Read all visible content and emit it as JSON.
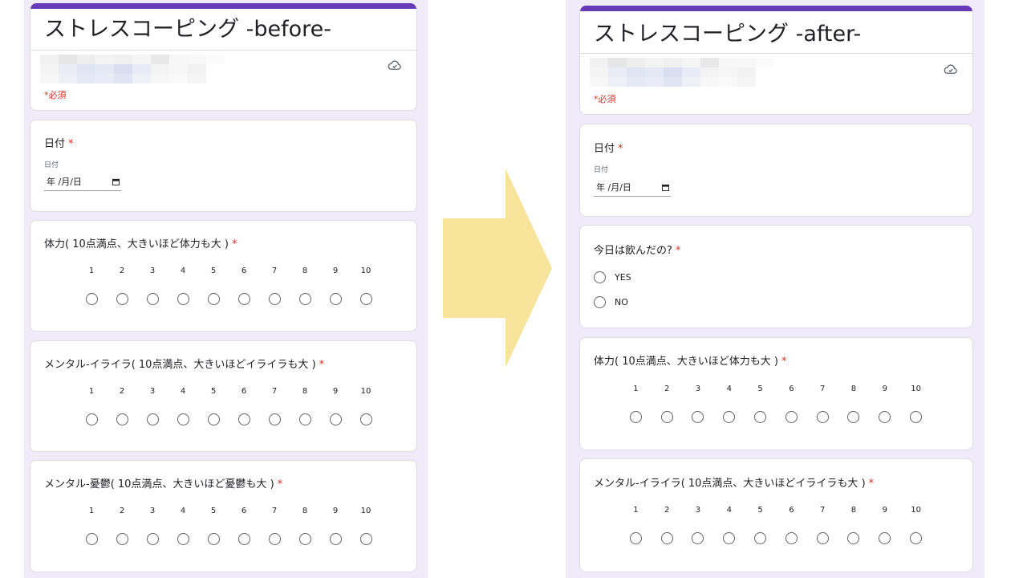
{
  "before": {
    "title": "ストレスコーピング -before-",
    "required_note": "*必須",
    "questions": [
      {
        "title": "日付",
        "sub_label": "日付",
        "date_value": "年 /月/日"
      },
      {
        "title": "体力( 10点満点、大きいほど体力も大 )",
        "scale": [
          "1",
          "2",
          "3",
          "4",
          "5",
          "6",
          "7",
          "8",
          "9",
          "10"
        ]
      },
      {
        "title": "メンタル-イライラ( 10点満点、大きいほどイライラも大 )",
        "scale": [
          "1",
          "2",
          "3",
          "4",
          "5",
          "6",
          "7",
          "8",
          "9",
          "10"
        ]
      },
      {
        "title": "メンタル-憂鬱( 10点満点、大きいほど憂鬱も大 )",
        "scale": [
          "1",
          "2",
          "3",
          "4",
          "5",
          "6",
          "7",
          "8",
          "9",
          "10"
        ]
      }
    ]
  },
  "after": {
    "title": "ストレスコーピング -after-",
    "required_note": "*必須",
    "questions": [
      {
        "title": "日付",
        "sub_label": "日付",
        "date_value": "年 /月/日"
      },
      {
        "title": "今日は飲んだの?",
        "options": [
          "YES",
          "NO"
        ]
      },
      {
        "title": "体力( 10点満点、大きいほど体力も大 )",
        "scale": [
          "1",
          "2",
          "3",
          "4",
          "5",
          "6",
          "7",
          "8",
          "9",
          "10"
        ]
      },
      {
        "title": "メンタル-イライラ( 10点満点、大きいほどイライラも大 )",
        "scale": [
          "1",
          "2",
          "3",
          "4",
          "5",
          "6",
          "7",
          "8",
          "9",
          "10"
        ]
      }
    ]
  },
  "required_star": "*",
  "icons": {
    "cloud": "cloud-saved-icon",
    "calendar": "calendar-icon",
    "arrow": "right-arrow"
  },
  "colors": {
    "accent": "#673ab7",
    "page_background": "#f0ebf8",
    "required": "#d93025",
    "arrow": "#f7e49a"
  }
}
